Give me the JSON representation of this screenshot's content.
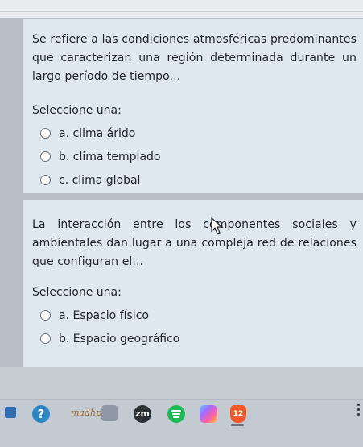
{
  "question1": {
    "text": "Se refiere a las condiciones atmosféricas predominantes que caracterizan una región determinada durante un largo período de tiempo...",
    "prompt": "Seleccione una:",
    "options": [
      {
        "label": "a. clima árido"
      },
      {
        "label": "b. clima templado"
      },
      {
        "label": "c. clima global"
      }
    ]
  },
  "question2": {
    "text": "La interacción entre los componentes sociales y ambientales dan lugar a una compleja red de relaciones que configuran el...",
    "prompt": "Seleccione una:",
    "options": [
      {
        "label": "a. Espacio físico"
      },
      {
        "label": "b. Espacio geográfico"
      }
    ]
  },
  "taskbar": {
    "icons": [
      "grid-app-icon",
      "help-icon",
      "wordpad-icon",
      "app-square-icon",
      "zoom-icon",
      "spotify-icon",
      "copilot-icon",
      "brave-icon"
    ],
    "help_glyph": "?",
    "wordpad_text": "madhp",
    "zoom_text": "zm",
    "brave_badge": "12"
  }
}
